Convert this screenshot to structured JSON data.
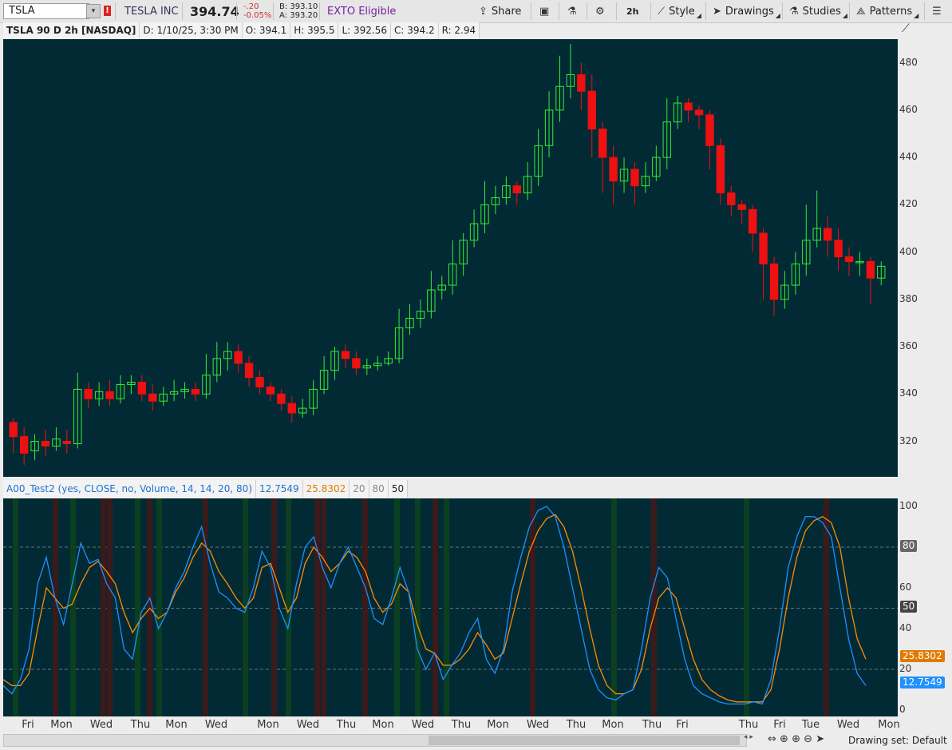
{
  "toolbar": {
    "symbol": "TSLA",
    "alert_badge": "!",
    "company": "TESLA INC",
    "last": "394.74",
    "change": "-.20",
    "change_pct": "-0.05%",
    "bid": "B: 393.10",
    "ask": "A: 393.20",
    "exto": "EXTO Eligible",
    "share": "Share",
    "timeframe": "2h",
    "style": "Style",
    "drawings": "Drawings",
    "studies": "Studies",
    "patterns": "Patterns"
  },
  "header": {
    "title": "TSLA 90 D 2h [NASDAQ]",
    "date": "D: 1/10/25, 3:30 PM",
    "open": "O: 394.1",
    "high": "H: 395.5",
    "low": "L: 392.56",
    "close": "C: 394.2",
    "range": "R: 2.94"
  },
  "indicator": {
    "name": "A00_Test2 (yes, CLOSE, no, Volume, 14, 14, 20, 80)",
    "value1": "12.7549",
    "value2": "25.8302",
    "level_low": "20",
    "level_high": "80",
    "level_mid": "50",
    "color1": "#1e90ff",
    "color2": "#ff8c00"
  },
  "price_axis": [
    "480",
    "460",
    "440",
    "420",
    "400",
    "380",
    "360",
    "340",
    "320"
  ],
  "osc_axis": [
    "100",
    "60",
    "40",
    "20",
    "0"
  ],
  "osc_tags": {
    "level_80": "80",
    "level_50": "50",
    "v2": "25.8302",
    "v1": "12.7549"
  },
  "time_axis": [
    "Fri",
    "Mon",
    "Wed",
    "Thu",
    "Mon",
    "Wed",
    "Mon",
    "Wed",
    "Thu",
    "Mon",
    "Wed",
    "Thu",
    "Mon",
    "Wed",
    "Thu",
    "Mon",
    "Thu",
    "Fri",
    "Thu",
    "Fri",
    "Tue",
    "Wed",
    "Mon"
  ],
  "status": {
    "drawing_set": "Drawing set: Default"
  },
  "colors": {
    "background": "#022a35",
    "up": "#33ee33",
    "down": "#ee1111"
  },
  "chart_data": {
    "type": "candlestick",
    "title": "TSLA 90 D 2h [NASDAQ]",
    "ylim": [
      305,
      490
    ],
    "candles": [
      [
        328,
        322,
        330,
        315
      ],
      [
        322,
        315,
        326,
        310
      ],
      [
        316,
        320,
        323,
        312
      ],
      [
        320,
        318,
        325,
        314
      ],
      [
        318,
        321,
        326,
        316
      ],
      [
        320,
        319,
        325,
        315
      ],
      [
        319,
        342,
        349,
        317
      ],
      [
        342,
        338,
        345,
        334
      ],
      [
        338,
        341,
        345,
        335
      ],
      [
        341,
        338,
        346,
        335
      ],
      [
        338,
        344,
        348,
        336
      ],
      [
        344,
        345,
        348,
        340
      ],
      [
        345,
        340,
        348,
        337
      ],
      [
        340,
        337,
        344,
        333
      ],
      [
        337,
        340,
        343,
        335
      ],
      [
        340,
        341,
        346,
        337
      ],
      [
        341,
        342,
        345,
        338
      ],
      [
        342,
        340,
        345,
        337
      ],
      [
        340,
        348,
        357,
        338
      ],
      [
        348,
        355,
        362,
        345
      ],
      [
        355,
        358,
        362,
        350
      ],
      [
        358,
        353,
        361,
        349
      ],
      [
        353,
        347,
        356,
        343
      ],
      [
        347,
        343,
        350,
        340
      ],
      [
        343,
        340,
        345,
        337
      ],
      [
        340,
        336,
        342,
        333
      ],
      [
        336,
        332,
        339,
        328
      ],
      [
        332,
        334,
        338,
        330
      ],
      [
        334,
        342,
        346,
        331
      ],
      [
        342,
        350,
        356,
        340
      ],
      [
        350,
        358,
        360,
        346
      ],
      [
        358,
        355,
        361,
        351
      ],
      [
        355,
        351,
        358,
        348
      ],
      [
        351,
        352,
        355,
        348
      ],
      [
        352,
        353,
        356,
        350
      ],
      [
        353,
        355,
        358,
        352
      ],
      [
        355,
        368,
        376,
        353
      ],
      [
        368,
        372,
        378,
        365
      ],
      [
        372,
        375,
        380,
        368
      ],
      [
        375,
        384,
        392,
        372
      ],
      [
        384,
        386,
        390,
        380
      ],
      [
        386,
        395,
        405,
        382
      ],
      [
        395,
        405,
        408,
        390
      ],
      [
        405,
        412,
        418,
        402
      ],
      [
        412,
        420,
        430,
        408
      ],
      [
        420,
        423,
        428,
        416
      ],
      [
        423,
        428,
        432,
        420
      ],
      [
        428,
        425,
        430,
        420
      ],
      [
        425,
        432,
        438,
        422
      ],
      [
        432,
        445,
        452,
        428
      ],
      [
        445,
        460,
        468,
        440
      ],
      [
        460,
        470,
        483,
        455
      ],
      [
        470,
        475,
        488,
        465
      ],
      [
        475,
        468,
        480,
        460
      ],
      [
        468,
        452,
        475,
        440
      ],
      [
        452,
        440,
        455,
        425
      ],
      [
        440,
        430,
        445,
        420
      ],
      [
        430,
        435,
        440,
        425
      ],
      [
        435,
        428,
        438,
        420
      ],
      [
        428,
        432,
        438,
        425
      ],
      [
        432,
        440,
        445,
        430
      ],
      [
        440,
        455,
        465,
        435
      ],
      [
        455,
        463,
        466,
        452
      ],
      [
        463,
        460,
        465,
        455
      ],
      [
        460,
        458,
        462,
        452
      ],
      [
        458,
        445,
        460,
        435
      ],
      [
        445,
        425,
        448,
        420
      ],
      [
        425,
        420,
        428,
        415
      ],
      [
        420,
        418,
        422,
        412
      ],
      [
        418,
        408,
        420,
        400
      ],
      [
        408,
        395,
        410,
        380
      ],
      [
        395,
        380,
        398,
        373
      ],
      [
        380,
        386,
        392,
        376
      ],
      [
        386,
        395,
        400,
        382
      ],
      [
        395,
        405,
        420,
        390
      ],
      [
        405,
        410,
        426,
        402
      ],
      [
        410,
        405,
        415,
        398
      ],
      [
        405,
        398,
        410,
        392
      ],
      [
        398,
        396,
        402,
        390
      ],
      [
        396,
        396,
        400,
        390
      ],
      [
        396,
        389,
        398,
        378
      ],
      [
        389,
        394,
        396,
        386
      ]
    ]
  }
}
